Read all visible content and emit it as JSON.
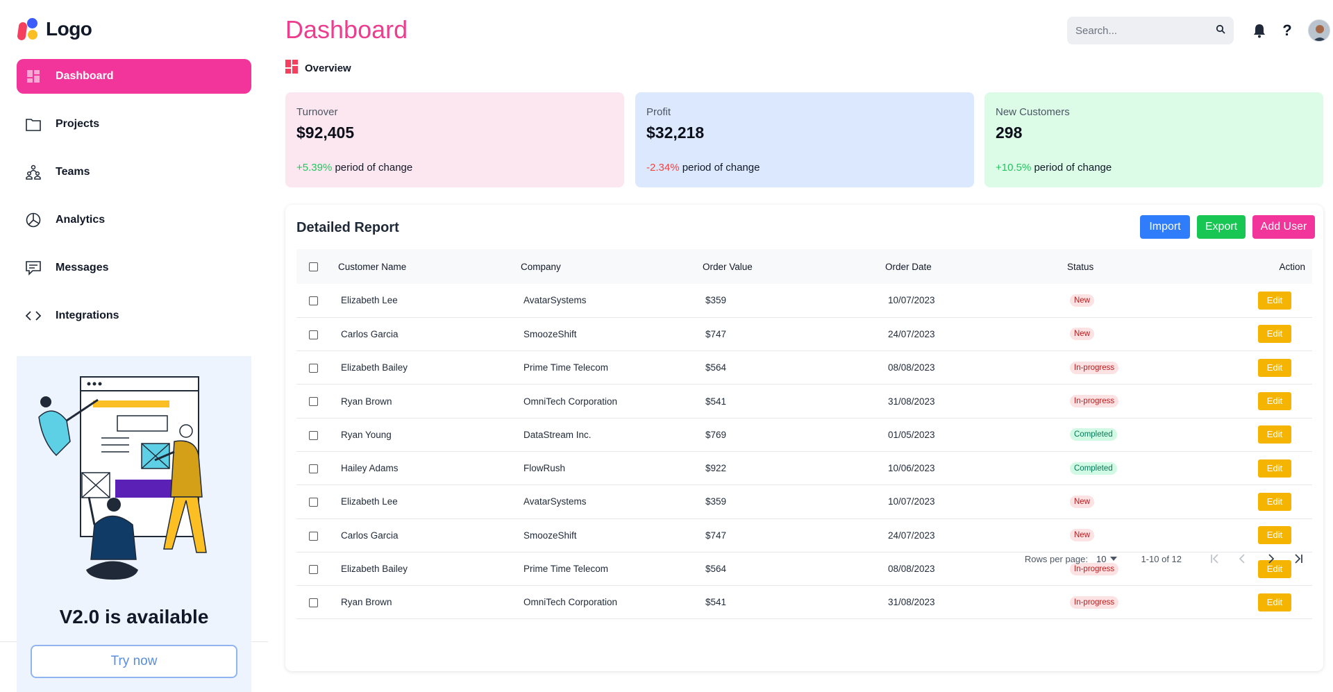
{
  "brand": {
    "logo_text": "Logo",
    "accent": "#f2359a"
  },
  "sidebar": {
    "items": [
      {
        "label": "Dashboard",
        "icon": "dashboard-grid-icon",
        "active": true
      },
      {
        "label": "Projects",
        "icon": "folder-icon"
      },
      {
        "label": "Teams",
        "icon": "teams-icon"
      },
      {
        "label": "Analytics",
        "icon": "pie-chart-icon"
      },
      {
        "label": "Messages",
        "icon": "message-icon"
      },
      {
        "label": "Integrations",
        "icon": "code-icon"
      }
    ],
    "promo": {
      "title": "V2.0 is available",
      "button": "Try now"
    }
  },
  "header": {
    "title": "Dashboard",
    "subtitle": "Overview",
    "search_placeholder": "Search...",
    "help_label": "?"
  },
  "stats": [
    {
      "label": "Turnover",
      "value": "$92,405",
      "change": "+5.39%",
      "change_suffix": " period of change",
      "trend": "up",
      "bg": "#fce7f0"
    },
    {
      "label": "Profit",
      "value": "$32,218",
      "change": "-2.34%",
      "change_suffix": " period of change",
      "trend": "down",
      "bg": "#dbe8fd"
    },
    {
      "label": "New Customers",
      "value": "298",
      "change": "+10.5%",
      "change_suffix": " period of change",
      "trend": "up",
      "bg": "#dcfce7"
    }
  ],
  "report": {
    "title": "Detailed Report",
    "buttons": {
      "import": "Import",
      "export": "Export",
      "add_user": "Add User"
    },
    "columns": [
      "Customer Name",
      "Company",
      "Order Value",
      "Order Date",
      "Status",
      "Action"
    ],
    "rows": [
      {
        "name": "Elizabeth Lee",
        "company": "AvatarSystems",
        "value": "$359",
        "date": "10/07/2023",
        "status": "New",
        "action": "Edit"
      },
      {
        "name": "Carlos Garcia",
        "company": "SmoozeShift",
        "value": "$747",
        "date": "24/07/2023",
        "status": "New",
        "action": "Edit"
      },
      {
        "name": "Elizabeth Bailey",
        "company": "Prime Time Telecom",
        "value": "$564",
        "date": "08/08/2023",
        "status": "In-progress",
        "action": "Edit"
      },
      {
        "name": "Ryan Brown",
        "company": "OmniTech Corporation",
        "value": "$541",
        "date": "31/08/2023",
        "status": "In-progress",
        "action": "Edit"
      },
      {
        "name": "Ryan Young",
        "company": "DataStream Inc.",
        "value": "$769",
        "date": "01/05/2023",
        "status": "Completed",
        "action": "Edit"
      },
      {
        "name": "Hailey Adams",
        "company": "FlowRush",
        "value": "$922",
        "date": "10/06/2023",
        "status": "Completed",
        "action": "Edit"
      },
      {
        "name": "Elizabeth Lee",
        "company": "AvatarSystems",
        "value": "$359",
        "date": "10/07/2023",
        "status": "New",
        "action": "Edit"
      },
      {
        "name": "Carlos Garcia",
        "company": "SmoozeShift",
        "value": "$747",
        "date": "24/07/2023",
        "status": "New",
        "action": "Edit"
      },
      {
        "name": "Elizabeth Bailey",
        "company": "Prime Time Telecom",
        "value": "$564",
        "date": "08/08/2023",
        "status": "In-progress",
        "action": "Edit"
      },
      {
        "name": "Ryan Brown",
        "company": "OmniTech Corporation",
        "value": "$541",
        "date": "31/08/2023",
        "status": "In-progress",
        "action": "Edit"
      }
    ],
    "pagination": {
      "rows_per_page_label": "Rows per page:",
      "rows_per_page": "10",
      "range": "1-10 of 12"
    }
  }
}
